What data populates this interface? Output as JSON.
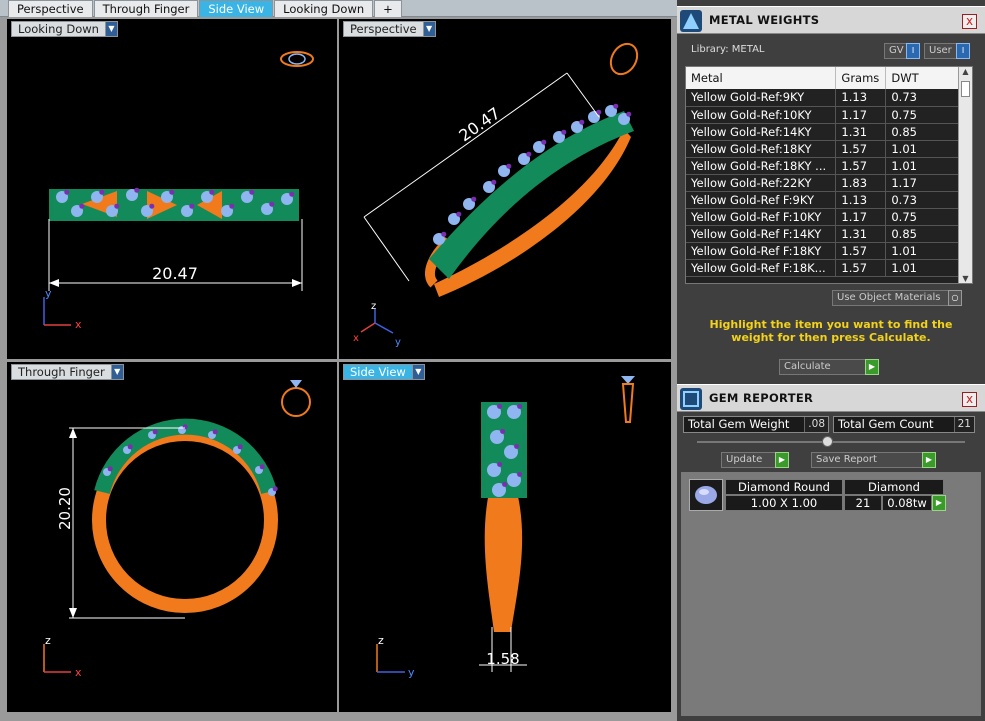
{
  "tabs": [
    {
      "label": "Perspective",
      "active": false
    },
    {
      "label": "Through Finger",
      "active": false
    },
    {
      "label": "Side View",
      "active": true
    },
    {
      "label": "Looking Down",
      "active": false
    }
  ],
  "add_tab_label": "+",
  "viewports": {
    "top_left": {
      "label": "Looking Down",
      "dimension": "20.47",
      "axis_x": "x",
      "axis_y": "y"
    },
    "top_right": {
      "label": "Perspective",
      "dimension": "20.47",
      "axis_x": "x",
      "axis_y": "y",
      "axis_z": "z"
    },
    "bottom_left": {
      "label": "Through Finger",
      "dimension": "20.20",
      "axis_x": "x",
      "axis_z": "z"
    },
    "bottom_right": {
      "label": "Side View",
      "dimension": "1.58",
      "axis_y": "y",
      "axis_z": "z"
    }
  },
  "metal_weights": {
    "title": "METAL WEIGHTS",
    "close": "x",
    "library_label": "Library: METAL",
    "gv_label": "GV",
    "user_label": "User",
    "columns": [
      "Metal",
      "Grams",
      "DWT"
    ],
    "rows": [
      [
        "Yellow Gold-Ref:9KY",
        "1.13",
        "0.73"
      ],
      [
        "Yellow Gold-Ref:10KY",
        "1.17",
        "0.75"
      ],
      [
        "Yellow Gold-Ref:14KY",
        "1.31",
        "0.85"
      ],
      [
        "Yellow Gold-Ref:18KY",
        "1.57",
        "1.01"
      ],
      [
        "Yellow Gold-Ref:18KY ...",
        "1.57",
        "1.01"
      ],
      [
        "Yellow Gold-Ref:22KY",
        "1.83",
        "1.17"
      ],
      [
        "Yellow Gold-Ref F:9KY",
        "1.13",
        "0.73"
      ],
      [
        "Yellow Gold-Ref F:10KY",
        "1.17",
        "0.75"
      ],
      [
        "Yellow Gold-Ref F:14KY",
        "1.31",
        "0.85"
      ],
      [
        "Yellow Gold-Ref F:18KY",
        "1.57",
        "1.01"
      ],
      [
        "Yellow Gold-Ref F:18K...",
        "1.57",
        "1.01"
      ]
    ],
    "use_object_materials": "Use Object Materials",
    "hint": "Highlight the item you want to find the weight for then press Calculate.",
    "calculate_label": "Calculate"
  },
  "gem_reporter": {
    "title": "GEM REPORTER",
    "close": "x",
    "total_weight_label": "Total Gem Weight",
    "total_weight_value": ".08",
    "total_count_label": "Total Gem Count",
    "total_count_value": "21",
    "update_label": "Update",
    "save_report_label": "Save Report",
    "gem": {
      "shape": "Diamond Round",
      "size": "1.00 X 1.00",
      "type": "Diamond",
      "count": "21",
      "weight": "0.08tw"
    }
  },
  "colors": {
    "metal": "#f07a1c",
    "head": "#138a5a",
    "stone": "#8fb6f0",
    "prong": "#7a2fb0",
    "accent_tab": "#3ab4e5",
    "hint_text": "#f2d21a"
  }
}
